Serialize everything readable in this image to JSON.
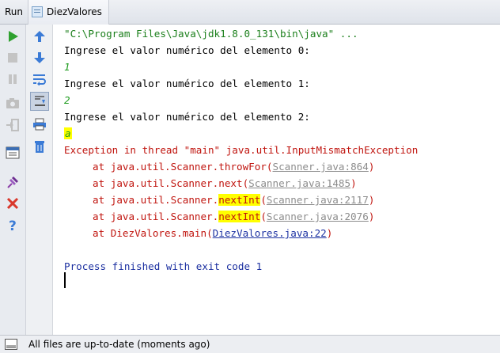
{
  "title_bar": {
    "run_label": "Run",
    "tab_label": "DiezValores"
  },
  "toolbar_left": [
    {
      "icon": "run-icon",
      "color": "#2fa12f"
    },
    {
      "icon": "stop-icon",
      "color": "#bfbfbf"
    },
    {
      "icon": "pause-icon",
      "color": "#bfbfbf"
    },
    {
      "icon": "camera-icon",
      "color": "#bfbfbf"
    },
    {
      "icon": "exit-icon",
      "color": "#bfbfbf"
    },
    {
      "icon": "layout-icon",
      "color": "#3c6eb4"
    },
    {
      "icon": "pin-icon",
      "color": "#8a3fa8"
    },
    {
      "icon": "close-icon",
      "color": "#d9382c"
    },
    {
      "icon": "help-icon",
      "color": "#3b7bd6"
    }
  ],
  "toolbar_right": [
    {
      "icon": "arrow-up-icon"
    },
    {
      "icon": "arrow-down-icon"
    },
    {
      "icon": "soft-wrap-icon"
    },
    {
      "icon": "scroll-to-end-icon"
    },
    {
      "icon": "print-icon"
    },
    {
      "icon": "trash-icon"
    }
  ],
  "console": {
    "command": "\"C:\\Program Files\\Java\\jdk1.8.0_131\\bin\\java\" ...",
    "prompt0": "Ingrese el valor numérico del elemento 0:",
    "input0": "1",
    "prompt1": "Ingrese el valor numérico del elemento 1:",
    "input1": "2",
    "prompt2": "Ingrese el valor numérico del elemento 2:",
    "input2": "a",
    "exception": "Exception in thread \"main\" java.util.InputMismatchException",
    "stack": [
      {
        "prefix": "at java.util.Scanner.",
        "method": "throwFor",
        "open": "(",
        "link": "Scanner.java:864",
        "close": ")"
      },
      {
        "prefix": "at java.util.Scanner.",
        "method": "next",
        "open": "(",
        "link": "Scanner.java:1485",
        "close": ")"
      },
      {
        "prefix": "at java.util.Scanner.",
        "method": "nextInt",
        "open": "(",
        "link": "Scanner.java:2117",
        "close": ")"
      },
      {
        "prefix": "at java.util.Scanner.",
        "method": "nextInt",
        "open": "(",
        "link": "Scanner.java:2076",
        "close": ")"
      },
      {
        "prefix": "at DiezValores.",
        "method": "main",
        "open": "(",
        "link": "DiezValores.java:22",
        "close": ")"
      }
    ],
    "exit_message": "Process finished with exit code 1"
  },
  "status_bar": {
    "message": "All files are up-to-date (moments ago)"
  }
}
